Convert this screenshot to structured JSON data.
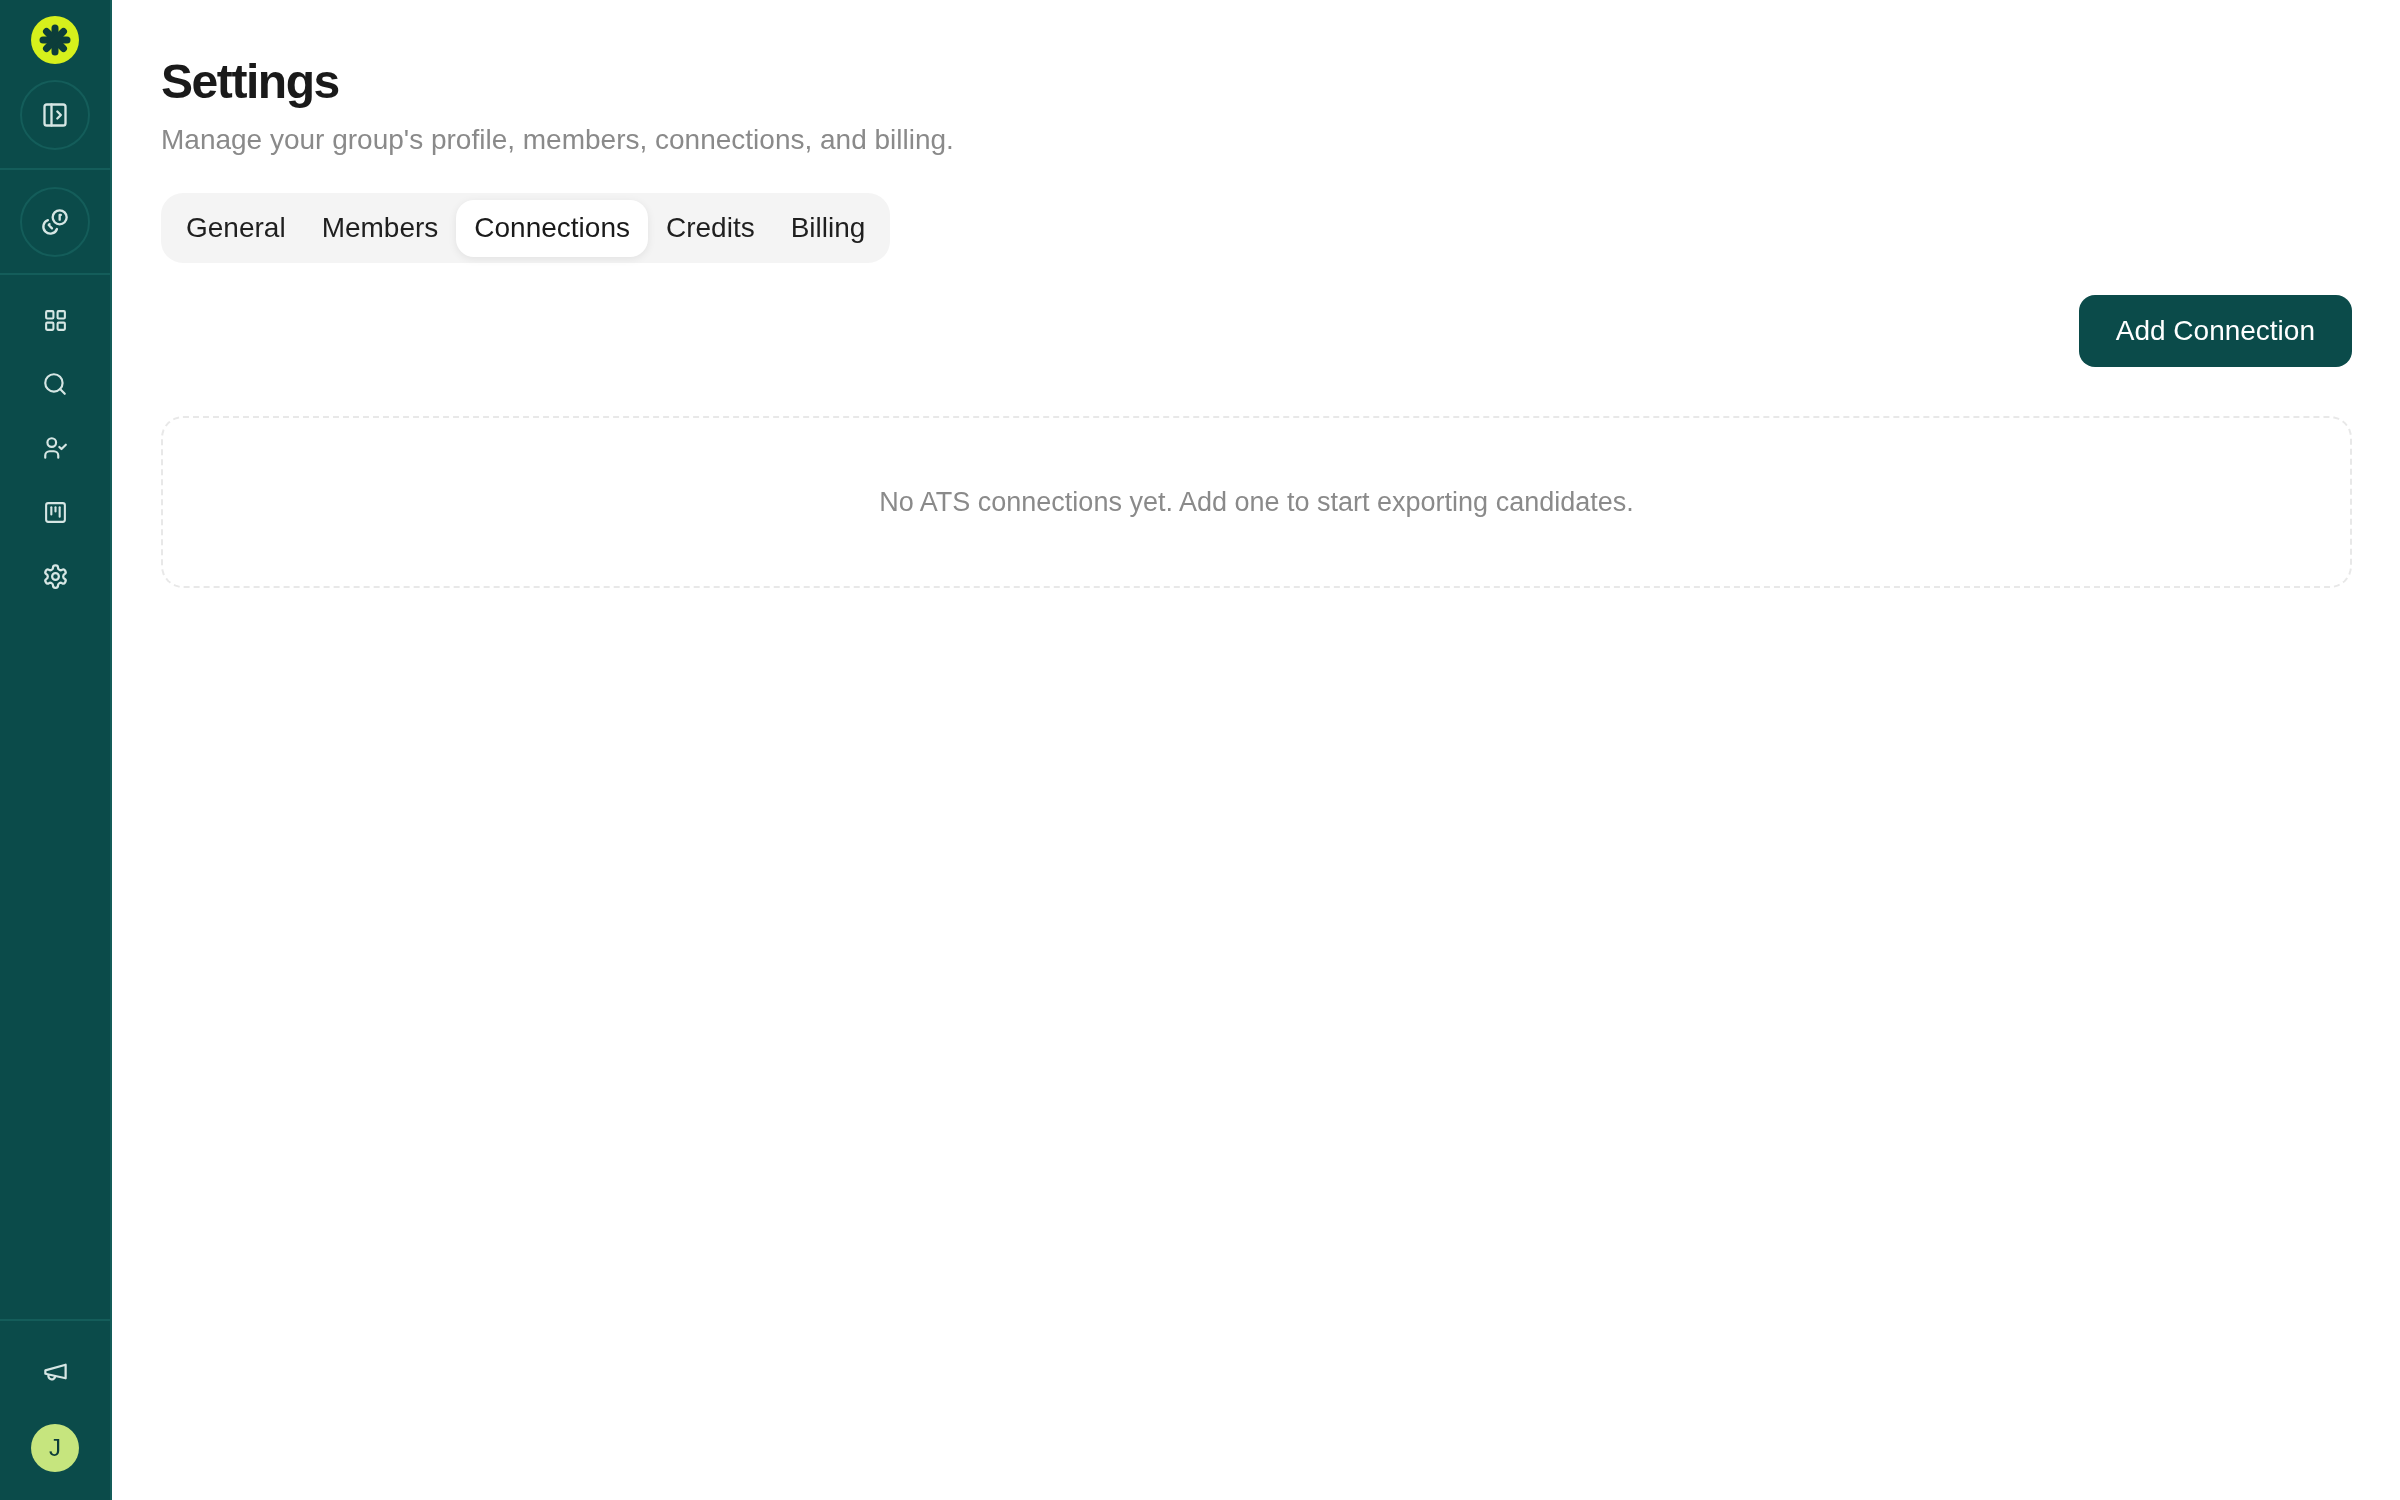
{
  "sidebar": {
    "avatar_initial": "J"
  },
  "header": {
    "title": "Settings",
    "subtitle": "Manage your group's profile, members, connections, and billing."
  },
  "tabs": [
    {
      "label": "General",
      "selected": false
    },
    {
      "label": "Members",
      "selected": false
    },
    {
      "label": "Connections",
      "selected": true
    },
    {
      "label": "Credits",
      "selected": false
    },
    {
      "label": "Billing",
      "selected": false
    }
  ],
  "actions": {
    "primary_button": {
      "label": "Add Connection"
    }
  },
  "empty_state": {
    "message": "No ATS connections yet. Add one to start exporting candidates."
  }
}
